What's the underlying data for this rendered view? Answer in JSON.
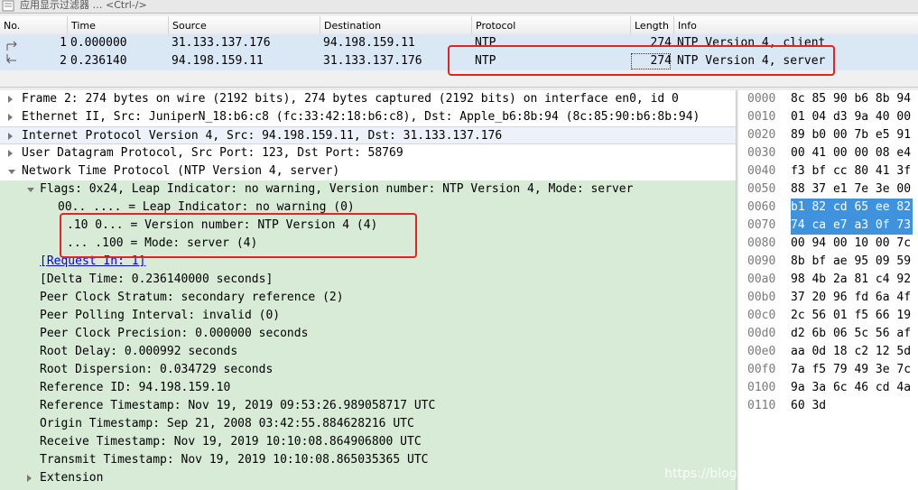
{
  "filter_bar": {
    "placeholder": "应用显示过滤器 … <Ctrl-/>"
  },
  "packet_list": {
    "columns": [
      "No.",
      "Time",
      "Source",
      "Destination",
      "Protocol",
      "Length",
      "Info"
    ],
    "rows": [
      {
        "no": "1",
        "time": "0.000000",
        "source": "31.133.137.176",
        "destination": "94.198.159.11",
        "protocol": "NTP",
        "length": "274",
        "info": "NTP Version 4, client"
      },
      {
        "no": "2",
        "time": "0.236140",
        "source": "94.198.159.11",
        "destination": "31.133.137.176",
        "protocol": "NTP",
        "length": "274",
        "info": "NTP Version 4, server"
      }
    ]
  },
  "details": {
    "top_level": [
      "Frame 2: 274 bytes on wire (2192 bits), 274 bytes captured (2192 bits) on interface en0, id 0",
      "Ethernet II, Src: JuniperN_18:b6:c8 (fc:33:42:18:b6:c8), Dst: Apple_b6:8b:94 (8c:85:90:b6:8b:94)",
      "Internet Protocol Version 4, Src: 94.198.159.11, Dst: 31.133.137.176",
      "User Datagram Protocol, Src Port: 123, Dst Port: 58769",
      "Network Time Protocol (NTP Version 4, server)"
    ],
    "flags": "Flags: 0x24, Leap Indicator: no warning, Version number: NTP Version 4, Mode: server",
    "flag_bits": [
      "00.. .... = Leap Indicator: no warning (0)",
      ".10 0... = Version number: NTP Version 4 (4)",
      "... .100 = Mode: server (4)"
    ],
    "request_in": "[Request In: 1]",
    "fields": [
      "[Delta Time: 0.236140000 seconds]",
      "Peer Clock Stratum: secondary reference (2)",
      "Peer Polling Interval: invalid (0)",
      "Peer Clock Precision: 0.000000 seconds",
      "Root Delay: 0.000992 seconds",
      "Root Dispersion: 0.034729 seconds",
      "Reference ID: 94.198.159.10",
      "Reference Timestamp: Nov 19, 2019 09:53:26.989058717 UTC",
      "Origin Timestamp: Sep 21, 2008 03:42:55.884628216 UTC",
      "Receive Timestamp: Nov 19, 2019 10:10:08.864906800 UTC",
      "Transmit Timestamp: Nov 19, 2019 10:10:08.865035365 UTC"
    ],
    "extension": "Extension"
  },
  "hex": {
    "rows": [
      {
        "offset": "0000",
        "bytes": "8c 85 90 b6 8b 94",
        "highlight": false
      },
      {
        "offset": "0010",
        "bytes": "01 04 d3 9a 40 00",
        "highlight": false
      },
      {
        "offset": "0020",
        "bytes": "89 b0 00 7b e5 91",
        "highlight": false
      },
      {
        "offset": "0030",
        "bytes": "00 41 00 00 08 e4",
        "highlight": false
      },
      {
        "offset": "0040",
        "bytes": "f3 bf cc 80 41 3f",
        "highlight": false
      },
      {
        "offset": "0050",
        "bytes": "88 37 e1 7e 3e 00",
        "highlight": false
      },
      {
        "offset": "0060",
        "bytes": "b1 82 cd 65 ee 82",
        "highlight": true
      },
      {
        "offset": "0070",
        "bytes": "74 ca e7 a3 0f 73",
        "highlight": true
      },
      {
        "offset": "0080",
        "bytes": "00 94 00 10 00 7c",
        "highlight": false
      },
      {
        "offset": "0090",
        "bytes": "8b bf ae 95 09 59",
        "highlight": false
      },
      {
        "offset": "00a0",
        "bytes": "98 4b 2a 81 c4 92",
        "highlight": false
      },
      {
        "offset": "00b0",
        "bytes": "37 20 96 fd 6a 4f",
        "highlight": false
      },
      {
        "offset": "00c0",
        "bytes": "2c 56 01 f5 66 19",
        "highlight": false
      },
      {
        "offset": "00d0",
        "bytes": "d2 6b 06 5c 56 af",
        "highlight": false
      },
      {
        "offset": "00e0",
        "bytes": "aa 0d 18 c2 12 5d",
        "highlight": false
      },
      {
        "offset": "00f0",
        "bytes": "7a f5 79 49 3e 7c",
        "highlight": false
      },
      {
        "offset": "0100",
        "bytes": "9a 3a 6c 46 cd 4a",
        "highlight": false
      },
      {
        "offset": "0110",
        "bytes": "60 3d",
        "highlight": false
      }
    ]
  },
  "watermark": "https://blog.csdn.net/chen1415886044",
  "colors": {
    "annotation": "#e52323",
    "details_bg": "#d7ebd7",
    "hex_highlight": "#3f93de",
    "row_selected": "#dae7f5"
  }
}
